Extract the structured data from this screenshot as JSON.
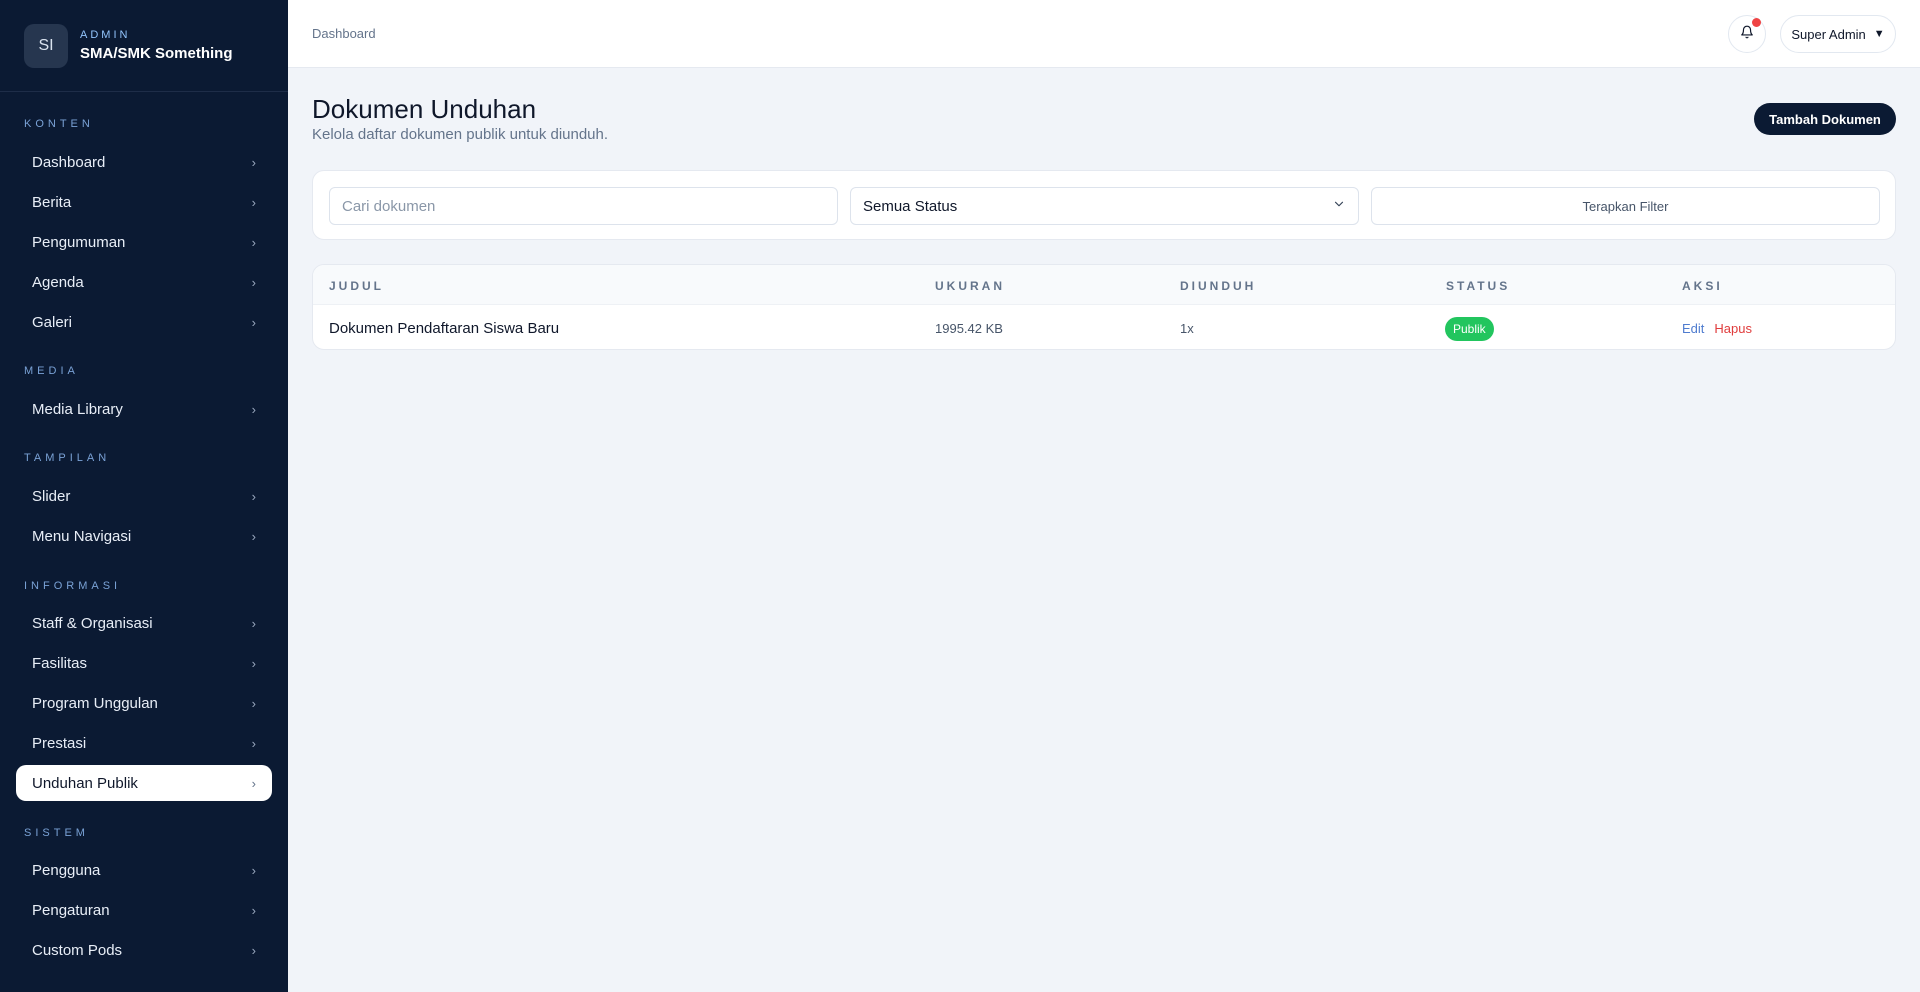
{
  "brand": {
    "logo": "SI",
    "sub": "ADMIN",
    "name": "SMA/SMK Something"
  },
  "sidebar": {
    "sections": [
      {
        "label": "KONTEN",
        "items": [
          "Dashboard",
          "Berita",
          "Pengumuman",
          "Agenda",
          "Galeri"
        ]
      },
      {
        "label": "MEDIA",
        "items": [
          "Media Library"
        ]
      },
      {
        "label": "TAMPILAN",
        "items": [
          "Slider",
          "Menu Navigasi"
        ]
      },
      {
        "label": "INFORMASI",
        "items": [
          "Staff & Organisasi",
          "Fasilitas",
          "Program Unggulan",
          "Prestasi",
          "Unduhan Publik"
        ]
      },
      {
        "label": "SISTEM",
        "items": [
          "Pengguna",
          "Pengaturan",
          "Custom Pods"
        ]
      }
    ],
    "active_item": "Unduhan Publik",
    "chevron_icon": "chevron-right-icon"
  },
  "topbar": {
    "breadcrumb": "Dashboard",
    "notification_icon": "bell-icon",
    "user_label": "Super Admin",
    "user_caret": "▼"
  },
  "page": {
    "title": "Dokumen Unduhan",
    "subtitle": "Kelola daftar dokumen publik untuk diunduh.",
    "add_button": "Tambah Dokumen"
  },
  "filters": {
    "search_placeholder": "Cari dokumen",
    "status_selected": "Semua Status",
    "apply_button": "Terapkan Filter"
  },
  "table": {
    "headers": [
      "JUDUL",
      "UKURAN",
      "DIUNDUH",
      "STATUS",
      "AKSI"
    ],
    "rows": [
      {
        "title": "Dokumen Pendaftaran Siswa Baru",
        "size": "1995.42 KB",
        "downloads": "1x",
        "status": "Publik",
        "edit": "Edit",
        "delete": "Hapus"
      }
    ]
  },
  "colors": {
    "sidebar_bg": "#0b1a33",
    "accent_dark": "#0b1a33",
    "status_public": "#22c55e",
    "danger": "#e03c3c",
    "link": "#4f7ccf"
  }
}
